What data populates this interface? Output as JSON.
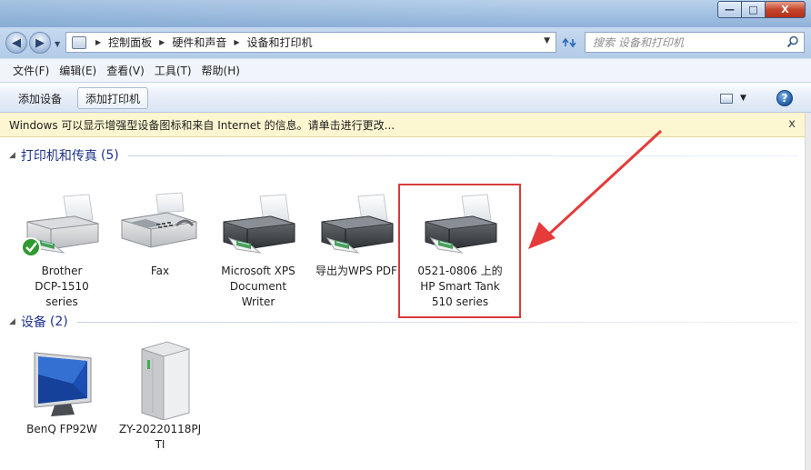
{
  "window": {
    "caption_buttons": {
      "min": "—",
      "max": "□",
      "close": "X"
    }
  },
  "address_bar": {
    "breadcrumbs": [
      "控制面板",
      "硬件和声音",
      "设备和打印机"
    ],
    "search_placeholder": "搜索 设备和打印机"
  },
  "menu": {
    "items": [
      "文件(F)",
      "编辑(E)",
      "查看(V)",
      "工具(T)",
      "帮助(H)"
    ]
  },
  "toolbar": {
    "add_device": "添加设备",
    "add_printer": "添加打印机",
    "help": "?"
  },
  "infobar": {
    "message": "Windows 可以显示增强型设备图标和来自 Internet 的信息。请单击进行更改...",
    "close": "x"
  },
  "groups": {
    "printers": {
      "title": "打印机和传真",
      "count": "(5)",
      "items": [
        {
          "line1": "Brother",
          "line2": "DCP-1510",
          "line3": "series",
          "default": true
        },
        {
          "line1": "Fax",
          "line2": "",
          "line3": ""
        },
        {
          "line1": "Microsoft XPS",
          "line2": "Document",
          "line3": "Writer"
        },
        {
          "line1": "导出为WPS PDF",
          "line2": "",
          "line3": ""
        },
        {
          "line1": "0521-0806 上的",
          "line2": "HP Smart Tank",
          "line3": "510 series"
        }
      ]
    },
    "devices": {
      "title": "设备",
      "count": "(2)",
      "items": [
        {
          "line1": "BenQ FP92W",
          "line2": ""
        },
        {
          "line1": "ZY-20220118PJ",
          "line2": "TI"
        }
      ]
    }
  },
  "colors": {
    "group_title": "#1e3287",
    "highlight": "#d93b3b",
    "infobar_bg": "#fcf6d1"
  }
}
